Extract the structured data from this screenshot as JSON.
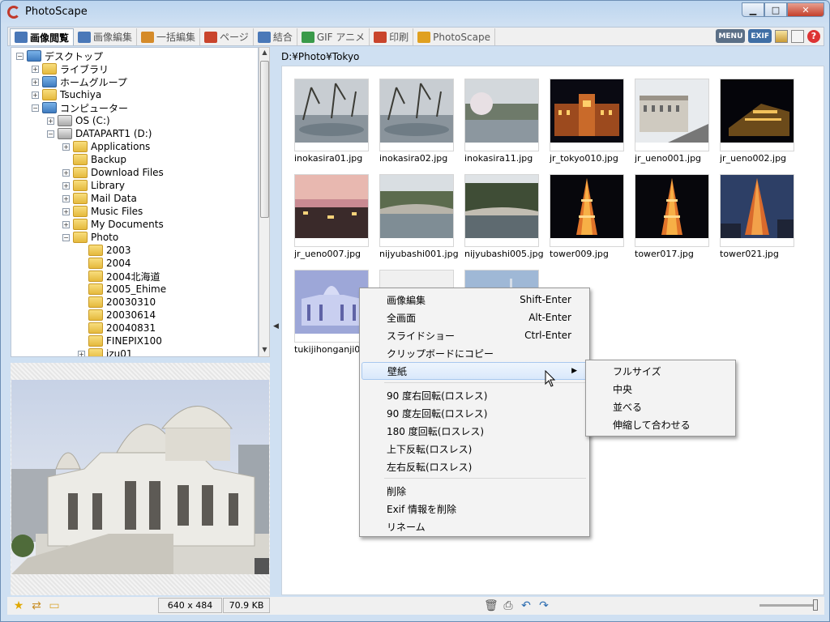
{
  "window": {
    "title": "PhotoScape"
  },
  "tabs": [
    "画像閲覧",
    "画像編集",
    "一括編集",
    "ページ",
    "結合",
    "GIF アニメ",
    "印刷",
    "PhotoScape"
  ],
  "toolbar": {
    "menu_label": "MENU",
    "exif_label": "EXIF",
    "help_label": "?"
  },
  "tab_icon_colors": [
    "#4a78b8",
    "#4a78b8",
    "#d58b2a",
    "#c9442c",
    "#4a78b8",
    "#3a9a4a",
    "#c9442c",
    "#e0a020"
  ],
  "tree": [
    {
      "label": "デスクトップ",
      "level": 0,
      "icon": "blue",
      "exp": "-"
    },
    {
      "label": "ライブラリ",
      "level": 1,
      "icon": "folder",
      "exp": "+"
    },
    {
      "label": "ホームグループ",
      "level": 1,
      "icon": "blue",
      "exp": "+"
    },
    {
      "label": "Tsuchiya",
      "level": 1,
      "icon": "folder",
      "exp": "+"
    },
    {
      "label": "コンピューター",
      "level": 1,
      "icon": "blue",
      "exp": "-"
    },
    {
      "label": "OS (C:)",
      "level": 2,
      "icon": "gray",
      "exp": "+"
    },
    {
      "label": "DATAPART1 (D:)",
      "level": 2,
      "icon": "gray",
      "exp": "-"
    },
    {
      "label": "Applications",
      "level": 3,
      "icon": "folder",
      "exp": "+"
    },
    {
      "label": "Backup",
      "level": 3,
      "icon": "folder",
      "exp": ""
    },
    {
      "label": "Download Files",
      "level": 3,
      "icon": "folder",
      "exp": "+"
    },
    {
      "label": "Library",
      "level": 3,
      "icon": "folder",
      "exp": "+"
    },
    {
      "label": "Mail Data",
      "level": 3,
      "icon": "folder",
      "exp": "+"
    },
    {
      "label": "Music Files",
      "level": 3,
      "icon": "folder",
      "exp": "+"
    },
    {
      "label": "My Documents",
      "level": 3,
      "icon": "folder",
      "exp": "+"
    },
    {
      "label": "Photo",
      "level": 3,
      "icon": "folder",
      "exp": "-"
    },
    {
      "label": "2003",
      "level": 4,
      "icon": "folder",
      "exp": ""
    },
    {
      "label": "2004",
      "level": 4,
      "icon": "folder",
      "exp": ""
    },
    {
      "label": "2004北海道",
      "level": 4,
      "icon": "folder",
      "exp": ""
    },
    {
      "label": "2005_Ehime",
      "level": 4,
      "icon": "folder",
      "exp": ""
    },
    {
      "label": "20030310",
      "level": 4,
      "icon": "folder",
      "exp": ""
    },
    {
      "label": "20030614",
      "level": 4,
      "icon": "folder",
      "exp": ""
    },
    {
      "label": "20040831",
      "level": 4,
      "icon": "folder",
      "exp": ""
    },
    {
      "label": "FINEPIX100",
      "level": 4,
      "icon": "folder",
      "exp": ""
    },
    {
      "label": "izu01",
      "level": 4,
      "icon": "folder",
      "exp": "+"
    }
  ],
  "path": "D:¥Photo¥Tokyo",
  "thumbnails": [
    {
      "name": "inokasira01.jpg",
      "kind": "park"
    },
    {
      "name": "inokasira02.jpg",
      "kind": "park"
    },
    {
      "name": "inokasira11.jpg",
      "kind": "lake"
    },
    {
      "name": "jr_tokyo010.jpg",
      "kind": "nightbuilding"
    },
    {
      "name": "jr_ueno001.jpg",
      "kind": "station"
    },
    {
      "name": "jr_ueno002.jpg",
      "kind": "nightbuilding2"
    },
    {
      "name": "jr_ueno007.jpg",
      "kind": "dusk"
    },
    {
      "name": "nijyubashi001.jpg",
      "kind": "bridge"
    },
    {
      "name": "nijyubashi005.jpg",
      "kind": "bridge2"
    },
    {
      "name": "tower009.jpg",
      "kind": "tower"
    },
    {
      "name": "tower017.jpg",
      "kind": "tower"
    },
    {
      "name": "tower021.jpg",
      "kind": "towerday"
    },
    {
      "name": "tukijihonganji00...",
      "kind": "temple"
    },
    {
      "name": "",
      "kind": "plain"
    },
    {
      "name": "",
      "kind": "sky"
    }
  ],
  "status": {
    "dimensions": "640 x 484",
    "filesize": "70.9 KB"
  },
  "context_menu": {
    "items": [
      {
        "label": "画像編集",
        "shortcut": "Shift-Enter"
      },
      {
        "label": "全画面",
        "shortcut": "Alt-Enter"
      },
      {
        "label": "スライドショー",
        "shortcut": "Ctrl-Enter"
      },
      {
        "label": "クリップボードにコピー",
        "shortcut": ""
      },
      {
        "label": "壁紙",
        "shortcut": "",
        "submenu": true
      },
      {
        "label": "90 度右回転(ロスレス)",
        "shortcut": ""
      },
      {
        "label": "90 度左回転(ロスレス)",
        "shortcut": ""
      },
      {
        "label": "180 度回転(ロスレス)",
        "shortcut": ""
      },
      {
        "label": "上下反転(ロスレス)",
        "shortcut": ""
      },
      {
        "label": "左右反転(ロスレス)",
        "shortcut": ""
      },
      {
        "label": "削除",
        "shortcut": ""
      },
      {
        "label": "Exif 情報を削除",
        "shortcut": ""
      },
      {
        "label": "リネーム",
        "shortcut": ""
      }
    ],
    "highlighted_index": 4
  },
  "wallpaper_submenu": [
    "フルサイズ",
    "中央",
    "並べる",
    "伸縮して合わせる"
  ]
}
